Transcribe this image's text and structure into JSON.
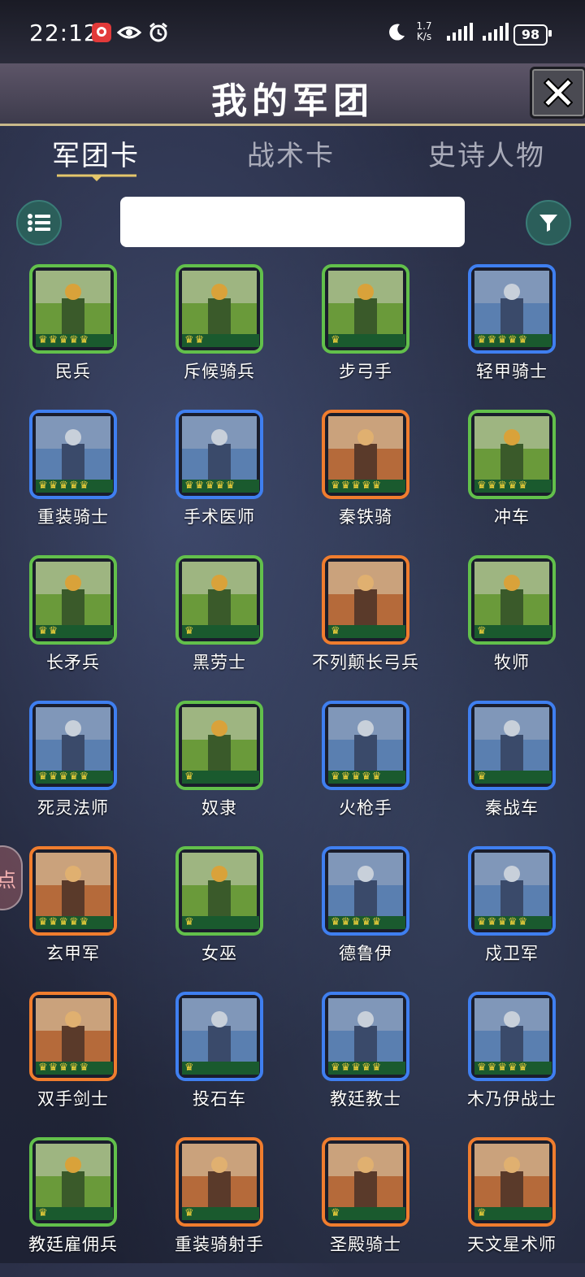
{
  "status_bar": {
    "time": "22:12",
    "net_speed_value": "1.7",
    "net_speed_unit": "K/s",
    "battery": "98"
  },
  "header": {
    "title": "我的军团",
    "close_icon": "close-x-icon"
  },
  "tabs": [
    {
      "label": "军团卡",
      "active": true
    },
    {
      "label": "战术卡",
      "active": false
    },
    {
      "label": "史诗人物",
      "active": false
    }
  ],
  "toolbar": {
    "menu_icon": "list-icon",
    "search_value": "",
    "filter_icon": "filter-icon"
  },
  "side_tab_label": "点",
  "colors": {
    "green": "#62c04b",
    "blue": "#3f7ff0",
    "orange": "#f07d2e"
  },
  "units": [
    {
      "name": "民兵",
      "rarity": "green",
      "crowns": 5
    },
    {
      "name": "斥候骑兵",
      "rarity": "green",
      "crowns": 2
    },
    {
      "name": "步弓手",
      "rarity": "green",
      "crowns": 1
    },
    {
      "name": "轻甲骑士",
      "rarity": "blue",
      "crowns": 5
    },
    {
      "name": "重装骑士",
      "rarity": "blue",
      "crowns": 5
    },
    {
      "name": "手术医师",
      "rarity": "blue",
      "crowns": 5
    },
    {
      "name": "秦铁骑",
      "rarity": "orange",
      "crowns": 5
    },
    {
      "name": "冲车",
      "rarity": "green",
      "crowns": 5
    },
    {
      "name": "长矛兵",
      "rarity": "green",
      "crowns": 2
    },
    {
      "name": "黑劳士",
      "rarity": "green",
      "crowns": 1
    },
    {
      "name": "不列颠长弓兵",
      "rarity": "orange",
      "crowns": 1
    },
    {
      "name": "牧师",
      "rarity": "green",
      "crowns": 1
    },
    {
      "name": "死灵法师",
      "rarity": "blue",
      "crowns": 5
    },
    {
      "name": "奴隶",
      "rarity": "green",
      "crowns": 1
    },
    {
      "name": "火枪手",
      "rarity": "blue",
      "crowns": 5
    },
    {
      "name": "秦战车",
      "rarity": "blue",
      "crowns": 1
    },
    {
      "name": "玄甲军",
      "rarity": "orange",
      "crowns": 5
    },
    {
      "name": "女巫",
      "rarity": "green",
      "crowns": 1
    },
    {
      "name": "德鲁伊",
      "rarity": "blue",
      "crowns": 5
    },
    {
      "name": "戍卫军",
      "rarity": "blue",
      "crowns": 5
    },
    {
      "name": "双手剑士",
      "rarity": "orange",
      "crowns": 5
    },
    {
      "name": "投石车",
      "rarity": "blue",
      "crowns": 1
    },
    {
      "name": "教廷教士",
      "rarity": "blue",
      "crowns": 5
    },
    {
      "name": "木乃伊战士",
      "rarity": "blue",
      "crowns": 5
    },
    {
      "name": "教廷雇佣兵",
      "rarity": "green",
      "crowns": 1
    },
    {
      "name": "重装骑射手",
      "rarity": "orange",
      "crowns": 1
    },
    {
      "name": "圣殿骑士",
      "rarity": "orange",
      "crowns": 1
    },
    {
      "name": "天文星术师",
      "rarity": "orange",
      "crowns": 1
    }
  ]
}
